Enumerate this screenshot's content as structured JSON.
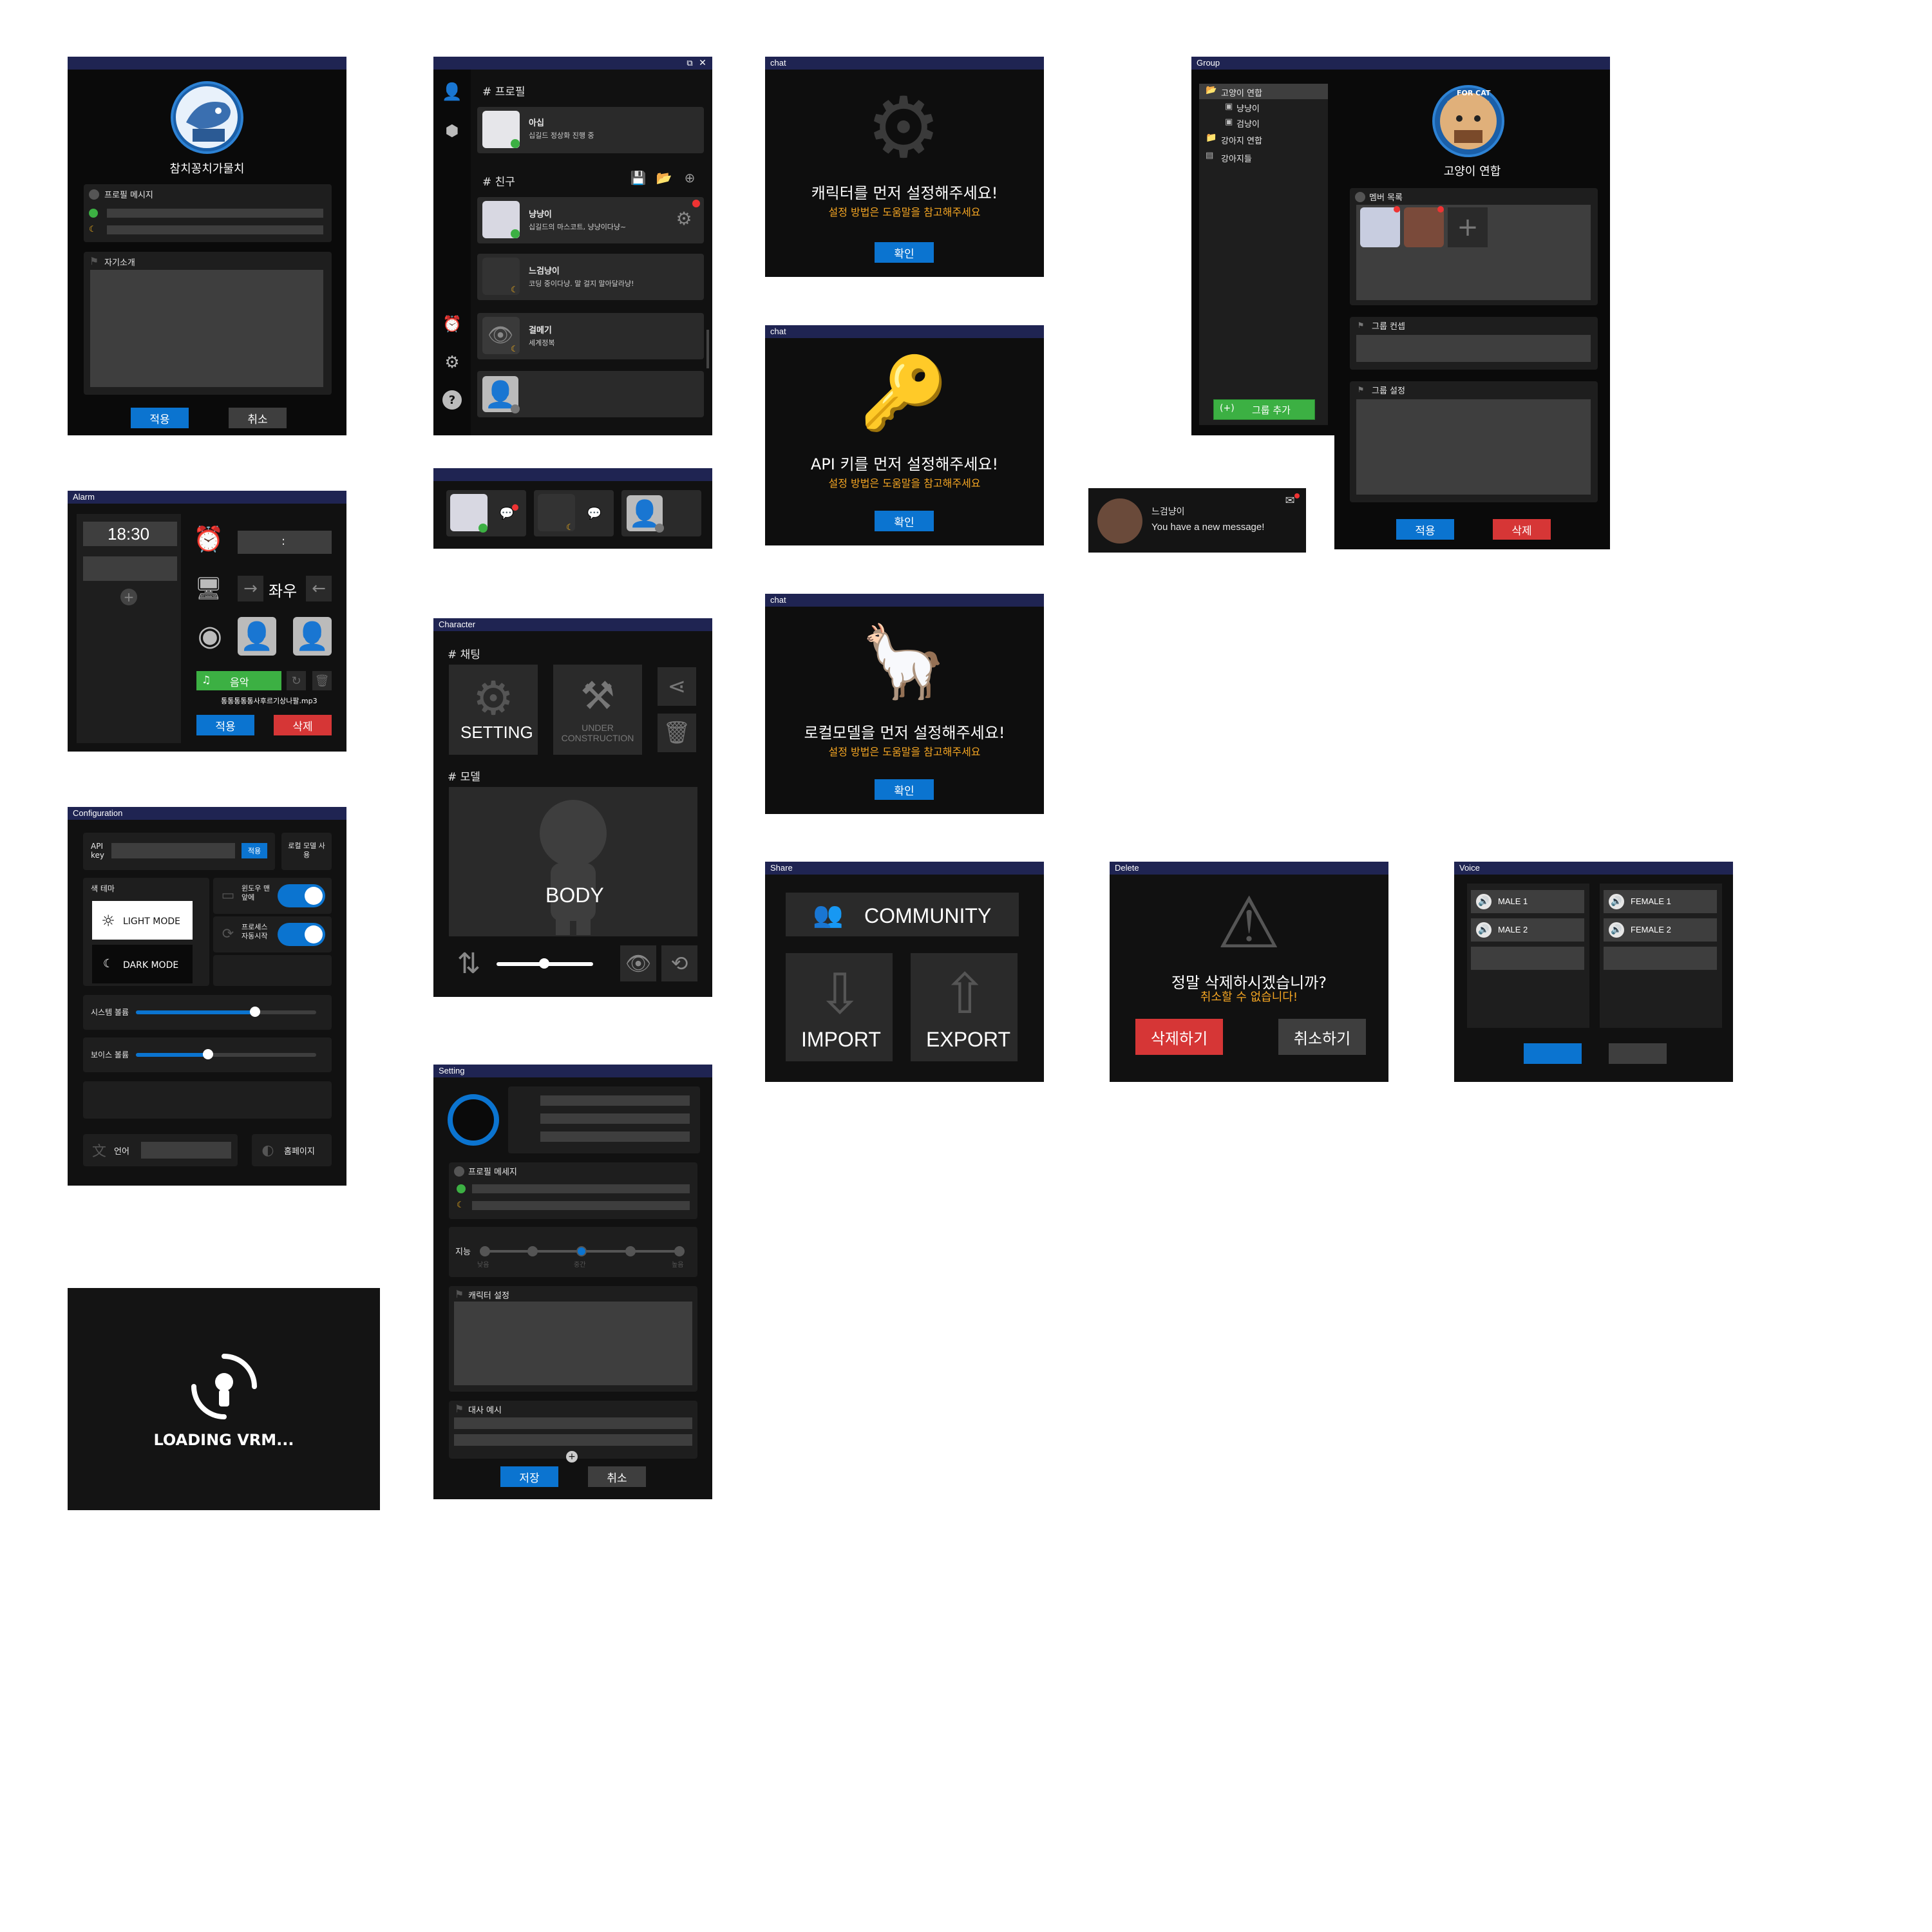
{
  "profile": {
    "name": "참치꽁치가물치",
    "message_label": "프로필 메시지",
    "intro_label": "자기소개",
    "apply": "적용",
    "cancel": "취소"
  },
  "friends": {
    "profile_header": "# 프로필",
    "me": {
      "name": "아십",
      "status": "십길드 정상화 진행 중"
    },
    "friends_header": "# 친구",
    "list": [
      {
        "name": "냥냥이",
        "status": "십길드의 마스코트, 냥냥이다냥~"
      },
      {
        "name": "느검냥이",
        "status": "코딩 중이다냥. 말 걸지 말아달라냥!"
      },
      {
        "name": "걸메기",
        "status": "세계정복"
      }
    ]
  },
  "chat1": {
    "title": "chat",
    "heading": "캐릭터를 먼저 설정해주세요!",
    "sub": "설정 방법은 도움말을 참고해주세요",
    "ok": "확인"
  },
  "chat2": {
    "title": "chat",
    "heading": "API 키를 먼저 설정해주세요!",
    "sub": "설정 방법은 도움말을 참고해주세요",
    "ok": "확인"
  },
  "chat3": {
    "title": "chat",
    "heading": "로컬모델을 먼저 설정해주세요!",
    "sub": "설정 방법은 도움말을 참고해주세요",
    "ok": "확인"
  },
  "group": {
    "title": "Group",
    "tree": [
      {
        "label": "고양이 연합",
        "level": 0
      },
      {
        "label": "냥냥이",
        "level": 1
      },
      {
        "label": "검냥이",
        "level": 1
      },
      {
        "label": "강아지 연합",
        "level": 0
      },
      {
        "label": "강아지들",
        "level": 0
      }
    ],
    "add_group": "그룹 추가",
    "name": "고양이 연합",
    "member_label": "멤버 목록",
    "concept_label": "그룹 컨셉",
    "setting_label": "그룹 설정",
    "apply": "적용",
    "delete": "삭제",
    "logo_text": "FOR CAT"
  },
  "notify": {
    "name": "느검냥이",
    "message": "You have a new message!"
  },
  "alarm": {
    "title": "Alarm",
    "time": "18:30",
    "colon": ":",
    "direction": "좌우",
    "music": "음악",
    "filename": "통통통통통사후르기상나팔.mp3",
    "apply": "적용",
    "delete": "삭제"
  },
  "character": {
    "title": "Character",
    "chat_header": "# 채팅",
    "setting": "SETTING",
    "under": "UNDER CONSTRUCTION",
    "model_header": "# 모델",
    "body": "BODY"
  },
  "share": {
    "title": "Share",
    "community": "COMMUNITY",
    "import": "IMPORT",
    "export": "EXPORT"
  },
  "delete": {
    "title": "Delete",
    "question": "정말 삭제하시겠습니까?",
    "warn": "취소할 수 없습니다!",
    "confirm": "삭제하기",
    "cancel": "취소하기"
  },
  "voice": {
    "title": "Voice",
    "male": [
      "MALE 1",
      "MALE 2"
    ],
    "female": [
      "FEMALE 1",
      "FEMALE 2"
    ]
  },
  "config": {
    "title": "Configuration",
    "api_label": "API key",
    "api_apply": "적용",
    "local_model": "로컬 모델 사용",
    "theme_label": "색 테마",
    "light": "LIGHT MODE",
    "dark": "DARK MODE",
    "window_front": "윈도우 맨 앞에",
    "process_auto": "프로세스 자동시작",
    "system_volume": "시스템 볼륨",
    "system_volume_value": 0.66,
    "voice_volume": "보이스 볼륨",
    "voice_volume_value": 0.4,
    "language": "언어",
    "homepage": "홈페이지"
  },
  "setting": {
    "title": "Setting",
    "message_label": "프로필 메세지",
    "intel_label": "지능",
    "intel_levels": [
      "낮음",
      "",
      "중간",
      "",
      "높음"
    ],
    "char_label": "캐릭터 설정",
    "dialog_label": "대사 예시",
    "save": "저장",
    "cancel": "취소"
  },
  "loading": {
    "text": "LOADING VRM..."
  },
  "colors": {
    "title_bar": "#1f2452",
    "accent": "#0b74d0",
    "danger": "#d63636",
    "success": "#3cb043",
    "warn": "#f5a623"
  }
}
